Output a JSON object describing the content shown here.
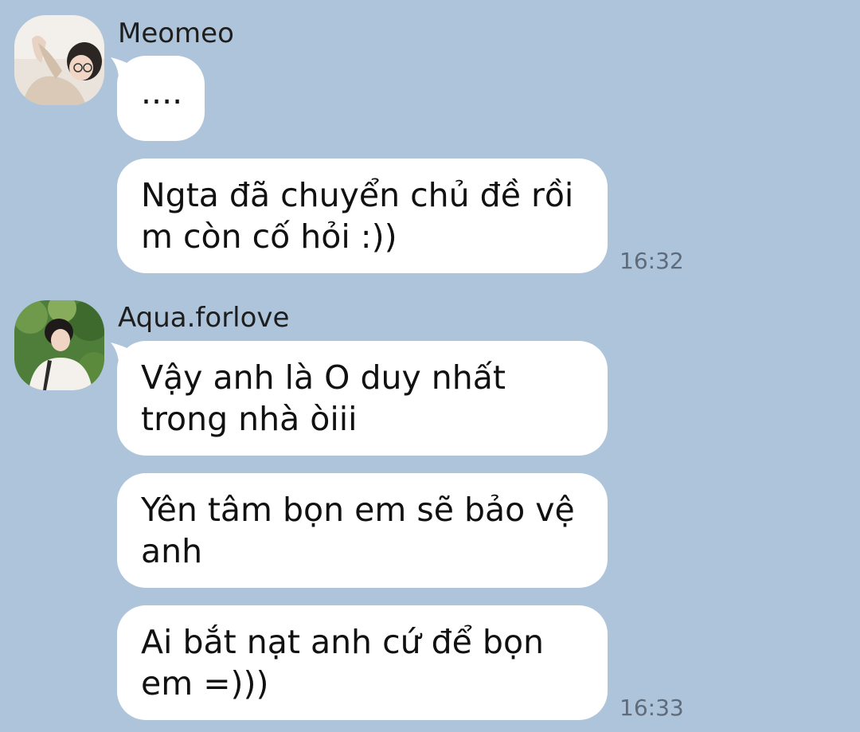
{
  "chat": {
    "groups": [
      {
        "sender": "Meomeo",
        "avatar_icon": "user-avatar-photo-icon",
        "messages": [
          {
            "text": "...."
          },
          {
            "text": "Ngta đã chuyển chủ đề rồi\nm còn cố hỏi :))"
          }
        ],
        "timestamp": "16:32"
      },
      {
        "sender": "Aqua.forlove",
        "avatar_icon": "user-avatar-photo-icon",
        "messages": [
          {
            "text": "Vậy anh là O duy nhất\ntrong nhà òiii"
          },
          {
            "text": "Yên tâm bọn em sẽ bảo vệ\nanh"
          },
          {
            "text": "Ai bắt nạt anh cứ để bọn\nem =)))"
          }
        ],
        "timestamp": "16:33"
      }
    ]
  },
  "colors": {
    "background": "#adc4db",
    "bubble": "#ffffff",
    "text": "#111111",
    "timestamp": "#5d6b7a"
  }
}
